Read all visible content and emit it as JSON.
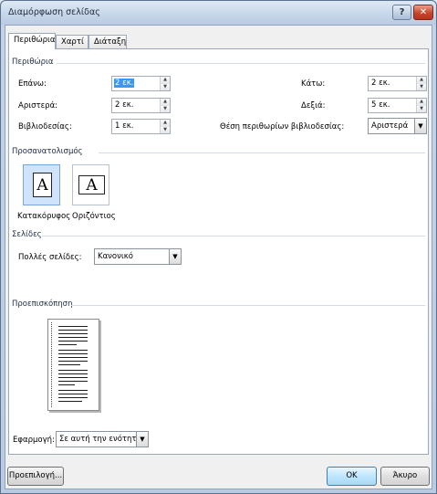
{
  "window": {
    "title": "Διαμόρφωση σελίδας"
  },
  "titlebar_buttons": {
    "help": "?",
    "close": "✕"
  },
  "tabs": [
    {
      "label": "Περιθώρια"
    },
    {
      "label": "Χαρτί"
    },
    {
      "label": "Διάταξη"
    }
  ],
  "margins": {
    "section_label": "Περιθώρια",
    "top": {
      "label": "Επάνω:",
      "value": "2 εκ."
    },
    "bottom": {
      "label": "Κάτω:",
      "value": "2 εκ."
    },
    "left": {
      "label": "Αριστερά:",
      "value": "2 εκ."
    },
    "right": {
      "label": "Δεξιά:",
      "value": "5 εκ."
    },
    "gutter": {
      "label": "Βιβλιοδεσίας:",
      "value": "1 εκ."
    },
    "gutter_position": {
      "label": "Θέση περιθωρίων βιβλιοδεσίας:",
      "value": "Αριστερά"
    }
  },
  "orientation": {
    "section_label": "Προσανατολισμός",
    "portrait": {
      "label": "Κατακόρυφος",
      "glyph": "A"
    },
    "landscape": {
      "label": "Οριζόντιος",
      "glyph": "A"
    }
  },
  "pages": {
    "section_label": "Σελίδες",
    "multiple_pages": {
      "label": "Πολλές σελίδες:",
      "value": "Κανονικό"
    }
  },
  "preview": {
    "section_label": "Προεπισκόπηση",
    "apply_to": {
      "label": "Εφαρμογή:",
      "value": "Σε αυτή την ενότητα"
    }
  },
  "buttons": {
    "default": "Προεπιλογή...",
    "ok": "OK",
    "cancel": "Άκυρο"
  },
  "colors": {
    "accent": "#3399ff",
    "titlebar": "#c7d7ea",
    "close": "#c8452b"
  }
}
